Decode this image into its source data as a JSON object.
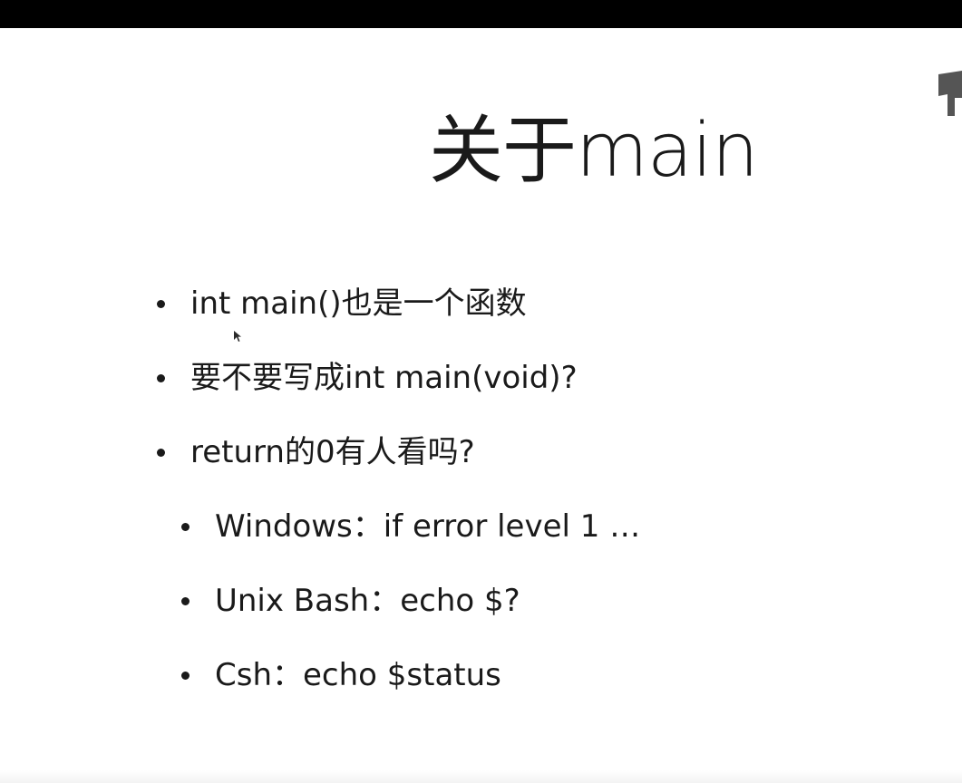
{
  "slide": {
    "title": "关于main",
    "bullets": [
      {
        "text": "int main()也是一个函数",
        "level": 1
      },
      {
        "text": "要不要写成int main(void)?",
        "level": 1
      },
      {
        "text": "return的0有人看吗?",
        "level": 1
      },
      {
        "text": "Windows：if error level 1 …",
        "level": 2
      },
      {
        "text": "Unix Bash：echo $?",
        "level": 2
      },
      {
        "text": "Csh：echo $status",
        "level": 2
      }
    ]
  },
  "colors": {
    "top_bar": "#000000",
    "background": "#ffffff",
    "text": "#1a1a1a"
  },
  "icons": {
    "cursor": "mouse-pointer-icon"
  }
}
